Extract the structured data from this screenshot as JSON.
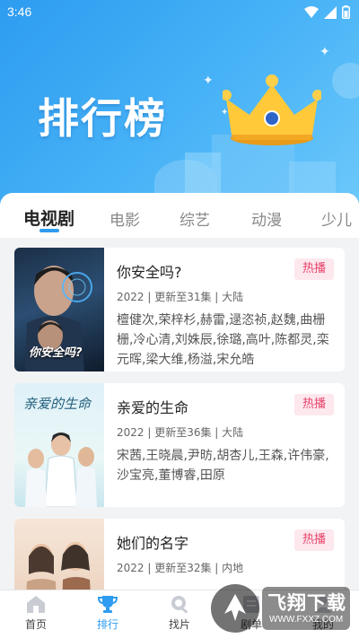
{
  "status_bar": {
    "time": "3:46"
  },
  "hero": {
    "title": "排行榜"
  },
  "tabs": [
    {
      "label": "电视剧",
      "active": true
    },
    {
      "label": "电影",
      "active": false
    },
    {
      "label": "综艺",
      "active": false
    },
    {
      "label": "动漫",
      "active": false
    },
    {
      "label": "少儿",
      "active": false
    }
  ],
  "cards": [
    {
      "title": "你安全吗?",
      "badge": "热播",
      "meta": "2022 | 更新至31集 | 大陆",
      "cast": "檀健次,荣梓杉,赫雷,逯恣祯,赵魏,曲栅栅,冷心清,刘姝辰,徐璐,高叶,陈都灵,栾元晖,梁大维,杨溢,宋允皓",
      "poster_text": "你安全吗?"
    },
    {
      "title": "亲爱的生命",
      "badge": "热播",
      "meta": "2022 | 更新至36集 | 大陆",
      "cast": "宋茜,王晓晨,尹昉,胡杏儿,王森,许伟豪,沙宝亮,董博睿,田原",
      "poster_text": "亲爱的生命"
    },
    {
      "title": "她们的名字",
      "badge": "热播",
      "meta": "2022 | 更新至32集 | 内地",
      "cast": "",
      "poster_text": ""
    }
  ],
  "bottom_nav": [
    {
      "label": "首页",
      "icon": "home-icon",
      "active": false
    },
    {
      "label": "排行",
      "icon": "trophy-icon",
      "active": true
    },
    {
      "label": "找片",
      "icon": "search-icon",
      "active": false
    },
    {
      "label": "剧单",
      "icon": "list-icon",
      "active": false
    },
    {
      "label": "我的",
      "icon": "user-icon",
      "active": false
    }
  ],
  "watermark": {
    "text": "飞翔下载",
    "subtext": "WWW.FXXZ.COM"
  },
  "colors": {
    "accent": "#2e9cf0",
    "badge_text": "#e8436a",
    "badge_bg": "#fde8ee"
  }
}
